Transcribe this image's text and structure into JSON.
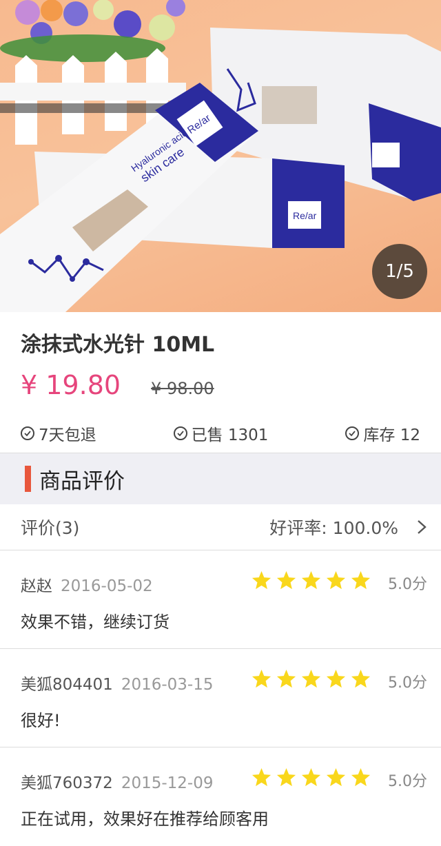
{
  "gallery": {
    "pager": "1/5"
  },
  "product": {
    "title": "涂抹式水光针 10ML",
    "price": "¥ 19.80",
    "original_price": "¥ 98.00",
    "meta": [
      "7天包退",
      "已售 1301",
      "库存 12"
    ]
  },
  "reviews_section": {
    "title": "商品评价",
    "count_label": "评价(3)",
    "rate_label": "好评率: 100.0%",
    "items": [
      {
        "user": "赵赵",
        "date": "2016-05-02",
        "rating": 5,
        "score": "5.0分",
        "text": "效果不错，继续订货"
      },
      {
        "user": "美狐804401",
        "date": "2016-03-15",
        "rating": 5,
        "score": "5.0分",
        "text": "很好!"
      },
      {
        "user": "美狐760372",
        "date": "2015-12-09",
        "rating": 5,
        "score": "5.0分",
        "text": "正在试用，效果好在推荐给顾客用"
      }
    ]
  },
  "colors": {
    "price": "#e6457c",
    "accent": "#e8573c",
    "star": "#f9d71c",
    "box_blue": "#2b2b9e"
  },
  "image_text": {
    "brand": "Re/ar",
    "line1": "Hyaluronic acid",
    "line2": "skin care"
  }
}
